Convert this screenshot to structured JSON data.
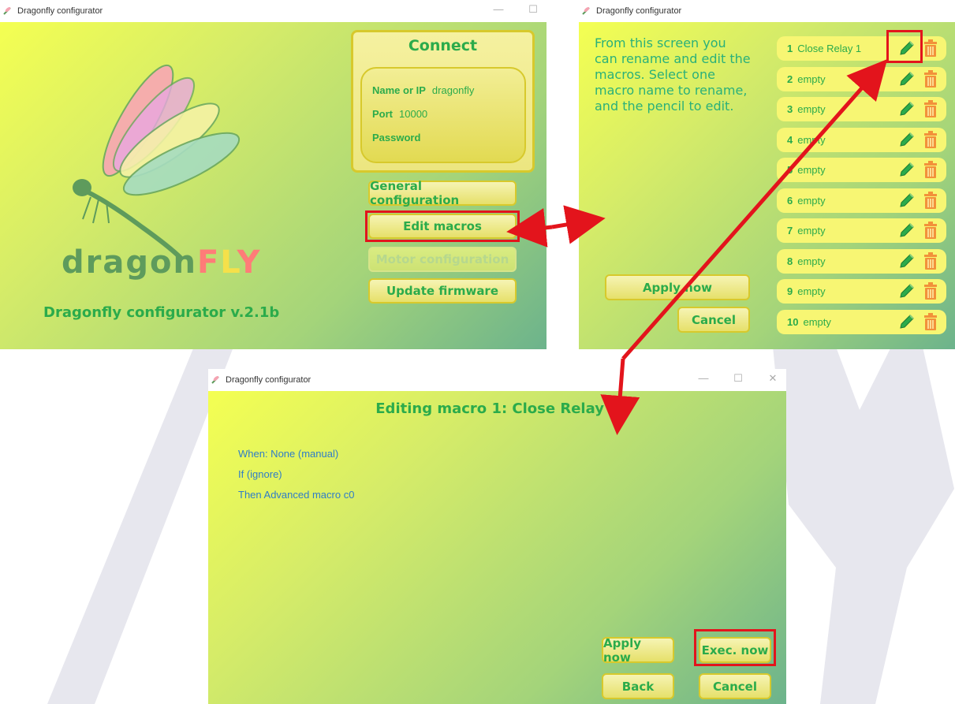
{
  "window_main": {
    "title": "Dragonfly configurator",
    "connect": {
      "title": "Connect",
      "name_label": "Name or IP",
      "name_value": "dragonfly",
      "port_label": "Port",
      "port_value": "10000",
      "password_label": "Password"
    },
    "buttons": {
      "general": "General configuration",
      "macros": "Edit macros",
      "motor": "Motor configuration",
      "update": "Update firmware"
    },
    "logo": {
      "part1": "dragon",
      "part2": "F",
      "part3": "L",
      "part4": "Y"
    },
    "version": "Dragonfly configurator v.2.1b"
  },
  "window_macros": {
    "title": "Dragonfly configurator",
    "info": "From this screen you can rename and edit the macros. Select one macro name to rename, and the pencil to edit.",
    "apply_label": "Apply now",
    "cancel_label": "Cancel",
    "macros": [
      {
        "num": "1",
        "name": "Close Relay 1"
      },
      {
        "num": "2",
        "name": "empty"
      },
      {
        "num": "3",
        "name": "empty"
      },
      {
        "num": "4",
        "name": "empty"
      },
      {
        "num": "5",
        "name": "empty"
      },
      {
        "num": "6",
        "name": "empty"
      },
      {
        "num": "7",
        "name": "empty"
      },
      {
        "num": "8",
        "name": "empty"
      },
      {
        "num": "9",
        "name": "empty"
      },
      {
        "num": "10",
        "name": "empty"
      }
    ]
  },
  "window_edit": {
    "title": "Dragonfly configurator",
    "heading": "Editing macro 1: Close Relay 1",
    "when": "When:  None (manual)",
    "if": "If (ignore)",
    "then": "Then Advanced macro c0",
    "apply_label": "Apply now",
    "exec_label": "Exec. now",
    "back_label": "Back",
    "cancel_label": "Cancel"
  },
  "colors": {
    "accent_green": "#2bab4b",
    "button_border": "#d7c92c",
    "highlight_red": "#e3141c",
    "text_blue": "#2f7dc8"
  }
}
